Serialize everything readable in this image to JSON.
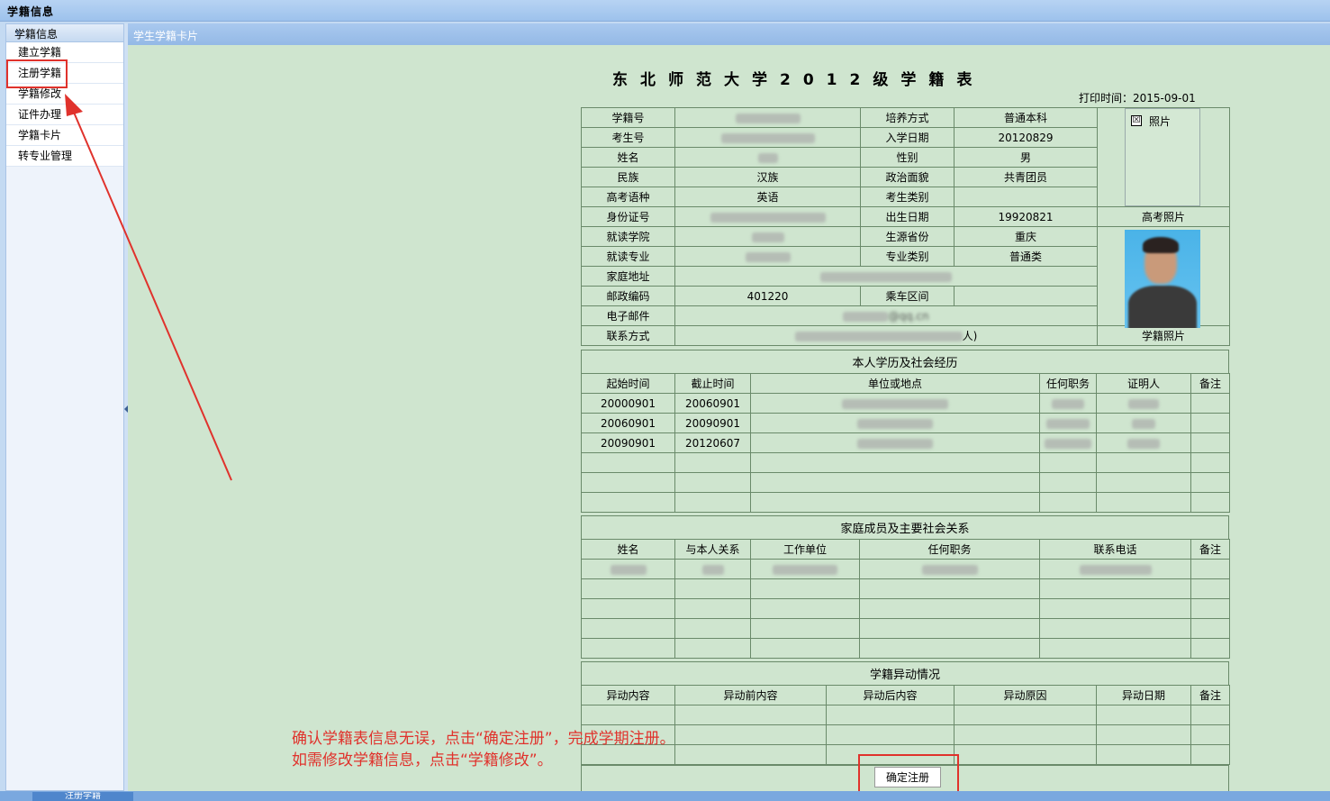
{
  "app": {
    "title": "学籍信息",
    "tab_title": "学生学籍卡片",
    "status_tab": "注册学籍"
  },
  "sidebar": {
    "header": "学籍信息",
    "items": [
      {
        "label": "建立学籍"
      },
      {
        "label": "注册学籍"
      },
      {
        "label": "学籍修改"
      },
      {
        "label": "证件办理"
      },
      {
        "label": "学籍卡片"
      },
      {
        "label": "转专业管理"
      }
    ]
  },
  "card": {
    "title": "东北师范大学2012级学籍表",
    "print_time": "打印时间：2015-09-01",
    "labels": {
      "xuejihao": "学籍号",
      "kaoshenghao": "考生号",
      "xingming": "姓名",
      "minzu": "民族",
      "gaokaoyuzhong": "高考语种",
      "shenfenzheng": "身份证号",
      "jiuduxueyuan": "就读学院",
      "jiuduzhuanye": "就读专业",
      "jiatingdizhi": "家庭地址",
      "youzhengbianma": "邮政编码",
      "dianziyoujian": "电子邮件",
      "lianxifangshi": "联系方式",
      "peiyangfangshi": "培养方式",
      "ruxueriqi": "入学日期",
      "xingbie": "性别",
      "zhengzhimianmao": "政治面貌",
      "kaoshengleibie": "考生类别",
      "chushengriqi": "出生日期",
      "shengyuanshengfen": "生源省份",
      "zhuanyeleibie": "专业类别",
      "chechequjian": "乘车区间"
    },
    "values": {
      "peiyangfangshi": "普通本科",
      "ruxueriqi": "20120829",
      "xingbie": "男",
      "minzu": "汉族",
      "zhengzhimianmao": "共青团员",
      "gaokaoyuzhong": "英语",
      "chushengriqi": "19920821",
      "shengyuanshengfen": "重庆",
      "zhuanyeleibie": "普通类",
      "youzhengbianma": "401220",
      "email_visible": "@qq.cn",
      "contact_suffix": "人)"
    },
    "photo": {
      "checkbox": "☒",
      "label": "照片",
      "gaokao_label": "高考照片",
      "xueji_label": "学籍照片"
    },
    "history": {
      "section": "本人学历及社会经历",
      "headers": [
        "起始时间",
        "截止时间",
        "单位或地点",
        "任何职务",
        "证明人",
        "备注"
      ],
      "rows": [
        {
          "start": "20000901",
          "end": "20060901"
        },
        {
          "start": "20060901",
          "end": "20090901"
        },
        {
          "start": "20090901",
          "end": "20120607"
        }
      ]
    },
    "family": {
      "section": "家庭成员及主要社会关系",
      "headers": [
        "姓名",
        "与本人关系",
        "工作单位",
        "任何职务",
        "联系电话",
        "备注"
      ]
    },
    "changes": {
      "section": "学籍异动情况",
      "headers": [
        "异动内容",
        "异动前内容",
        "异动后内容",
        "异动原因",
        "异动日期",
        "备注"
      ]
    },
    "confirm_button": "确定注册"
  },
  "hint": {
    "line1": "确认学籍表信息无误，点击“确定注册”，完成学期注册。",
    "line2": "如需修改学籍信息，点击“学籍修改”。"
  },
  "colors": {
    "annotation": "#e0322c",
    "content_bg": "#cfe5cf"
  }
}
